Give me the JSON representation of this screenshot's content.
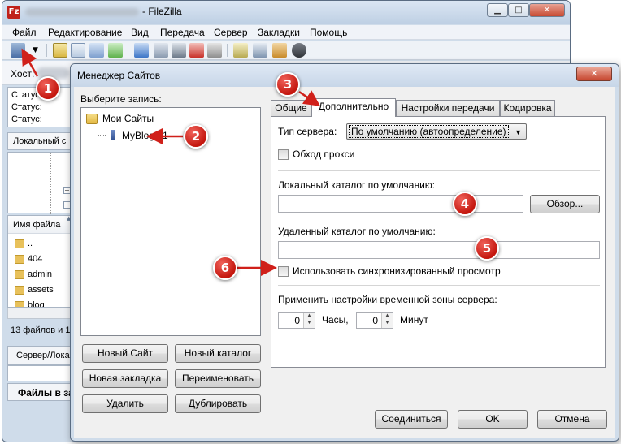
{
  "main_window": {
    "title": "- FileZilla",
    "menu": [
      "Файл",
      "Редактирование",
      "Вид",
      "Передача",
      "Сервер",
      "Закладки",
      "Помощь"
    ],
    "host_label": "Хост:",
    "log": [
      "Статус:",
      "Статус:",
      "Статус:"
    ],
    "local_site_label": "Локальный с",
    "file_column_name": "Имя файла",
    "files": [
      "..",
      "404",
      "admin",
      "assets",
      "blog"
    ],
    "file_count": "13 файлов и 1",
    "queue_tab": "Сервер/Лока",
    "bottom_tab": "Файлы в за"
  },
  "dialog": {
    "title": "Менеджер Сайтов",
    "close_label": "✕",
    "select_entry_label": "Выберите запись:",
    "tree": {
      "root": "Мои Сайты",
      "site": "MyBlog 01"
    },
    "buttons": {
      "new_site": "Новый Сайт",
      "new_folder": "Новый каталог",
      "new_bookmark": "Новая закладка",
      "rename": "Переименовать",
      "delete": "Удалить",
      "duplicate": "Дублировать",
      "connect": "Соединиться",
      "ok": "OK",
      "cancel": "Отмена"
    },
    "tabs": [
      "Общие",
      "Дополнительно",
      "Настройки передачи",
      "Кодировка"
    ],
    "active_tab": "Дополнительно",
    "advanced": {
      "server_type_label": "Тип сервера:",
      "server_type_value": "По умолчанию (автоопределение)",
      "bypass_proxy_label": "Обход прокси",
      "bypass_proxy_checked": false,
      "local_dir_label": "Локальный каталог по умолчанию:",
      "local_dir_value": "",
      "browse_button": "Обзор...",
      "remote_dir_label": "Удаленный каталог по умолчанию:",
      "remote_dir_value": "",
      "sync_browse_label": "Использовать синхронизированный просмотр",
      "sync_browse_checked": false,
      "timezone_label": "Применить настройки временной зоны сервера:",
      "hours_value": "0",
      "hours_label": "Часы,",
      "minutes_value": "0",
      "minutes_label": "Минут"
    }
  },
  "callouts": [
    "1",
    "2",
    "3",
    "4",
    "5",
    "6"
  ],
  "colors": {
    "callout_red": "#d0201a",
    "window_frame": "#cfdcea",
    "dialog_body": "#f0f0f0"
  }
}
